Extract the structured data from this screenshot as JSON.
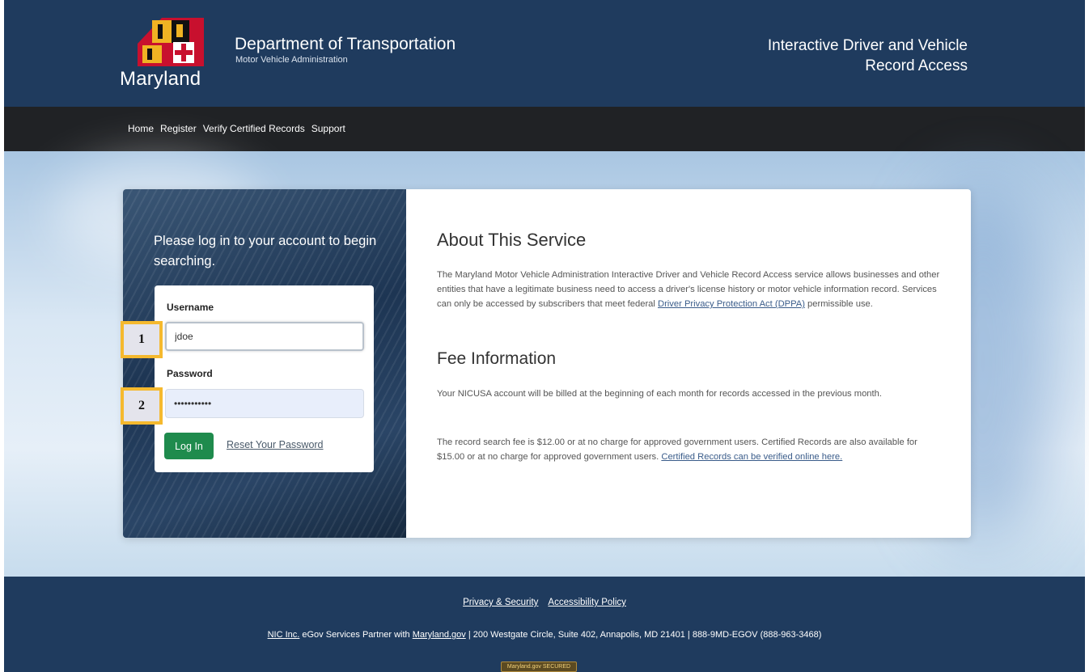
{
  "header": {
    "logo_text": "Maryland",
    "dept_title": "Department of Transportation",
    "dept_subtitle": "Motor Vehicle Administration",
    "site_title_line1": "Interactive Driver and Vehicle",
    "site_title_line2": "Record Access",
    "colors": {
      "background": "#1f3b5e",
      "flag_gold": "#f0b323",
      "flag_red": "#c8102e",
      "flag_black": "#111111"
    }
  },
  "nav": {
    "items": [
      {
        "label": "Home"
      },
      {
        "label": "Register"
      },
      {
        "label": "Verify Certified Records"
      },
      {
        "label": "Support"
      }
    ]
  },
  "login": {
    "intro": "Please log in to your account to begin searching.",
    "username_label": "Username",
    "username_value": "jdoe",
    "password_label": "Password",
    "password_value": "•••••••••••",
    "login_button": "Log In",
    "reset_link": "Reset Your Password",
    "button_color": "#1f8b4d"
  },
  "about": {
    "title": "About This Service",
    "para_before_link": "The Maryland Motor Vehicle Administration Interactive Driver and Vehicle Record Access service allows businesses and other entities that have a legitimate business need to access a driver's license history or motor vehicle information record. Services can only be accessed by subscribers that meet federal ",
    "para_link": "Driver Privacy Protection Act (DPPA)",
    "para_after_link": " permissible use."
  },
  "fee": {
    "title": "Fee Information",
    "para1": "Your NICUSA account will be billed at the beginning of each month for records accessed in the previous month.",
    "para2_text": "The record search fee is $12.00 or at no charge for approved government users. Certified Records are also available for $15.00 or at no charge for approved government users. ",
    "para2_link": "Certified Records can be verified online here."
  },
  "markers": {
    "one": "1",
    "two": "2"
  },
  "footer": {
    "link_privacy": "Privacy & Security",
    "link_accessibility": "Accessibility Policy",
    "nic_link": "NIC Inc.",
    "partner_text": " eGov Services Partner with ",
    "md_link": "Maryland.gov",
    "address_text": " | 200 Westgate Circle, Suite 402, Annapolis, MD 21401 | 888-9MD-EGOV (888-963-3468)",
    "seal_text": "Maryland.gov SECURED"
  }
}
